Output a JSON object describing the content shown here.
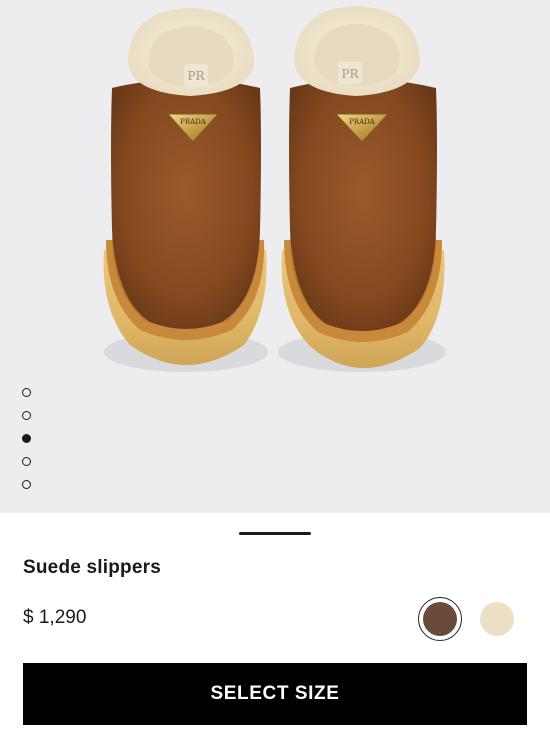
{
  "product": {
    "name": "Suede slippers",
    "price": "$ 1,290",
    "logo_text": "PRADA",
    "image_alt": "Product photo of brown suede slippers with shearling lining"
  },
  "gallery": {
    "dot_count": 5,
    "active_index": 2
  },
  "colors": {
    "options": [
      {
        "name": "brown",
        "hex": "#6b4a3a",
        "selected": true
      },
      {
        "name": "cream",
        "hex": "#ebdfc4",
        "selected": false
      }
    ]
  },
  "actions": {
    "select_size_label": "SELECT SIZE"
  }
}
